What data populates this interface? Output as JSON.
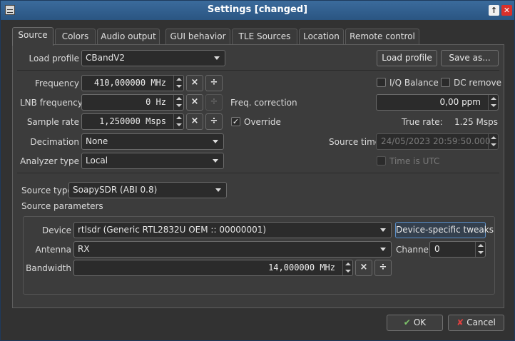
{
  "window": {
    "title": "Settings [changed]"
  },
  "tabs": [
    {
      "label": "Source"
    },
    {
      "label": "Colors"
    },
    {
      "label": "Audio output"
    },
    {
      "label": "GUI behavior"
    },
    {
      "label": "TLE Sources"
    },
    {
      "label": "Location"
    },
    {
      "label": "Remote control"
    }
  ],
  "profile": {
    "label": "Load profile",
    "value": "CBandV2",
    "load_button": "Load profile",
    "save_button": "Save as..."
  },
  "frequency": {
    "label": "Frequency",
    "value": "410,000000 MHz"
  },
  "lnb": {
    "label": "LNB frequency",
    "value": "0 Hz"
  },
  "sample_rate": {
    "label": "Sample rate",
    "value": "1,250000 Msps"
  },
  "decimation": {
    "label": "Decimation",
    "value": "None"
  },
  "analyzer": {
    "label": "Analyzer type",
    "value": "Local"
  },
  "iq_balance": {
    "label": "I/Q Balance",
    "checked": false
  },
  "dc_remove": {
    "label": "DC remove",
    "checked": false
  },
  "freq_correction": {
    "label": "Freq. correction",
    "value": "0,00 ppm"
  },
  "override": {
    "label": "Override",
    "checked": true
  },
  "true_rate": {
    "label": "True rate:",
    "value": "1.25 Msps"
  },
  "source_time": {
    "label": "Source time",
    "value": "24/05/2023 20:59:50.000"
  },
  "time_utc": {
    "label": "Time is UTC",
    "checked": false
  },
  "source_type": {
    "label": "Source type",
    "value": "SoapySDR (ABI 0.8)"
  },
  "source_params": {
    "label": "Source parameters"
  },
  "device": {
    "label": "Device",
    "value": "rtlsdr (Generic RTL2832U OEM :: 00000001)",
    "tweaks_button": "Device-specific tweaks"
  },
  "antenna": {
    "label": "Antenna",
    "value": "RX"
  },
  "channel": {
    "label": "Channel",
    "value": "0"
  },
  "bandwidth": {
    "label": "Bandwidth",
    "value": "14,000000 MHz"
  },
  "spin_buttons": {
    "clear": "×",
    "divide": "÷"
  },
  "dialog": {
    "ok": "OK",
    "cancel": "Cancel"
  }
}
